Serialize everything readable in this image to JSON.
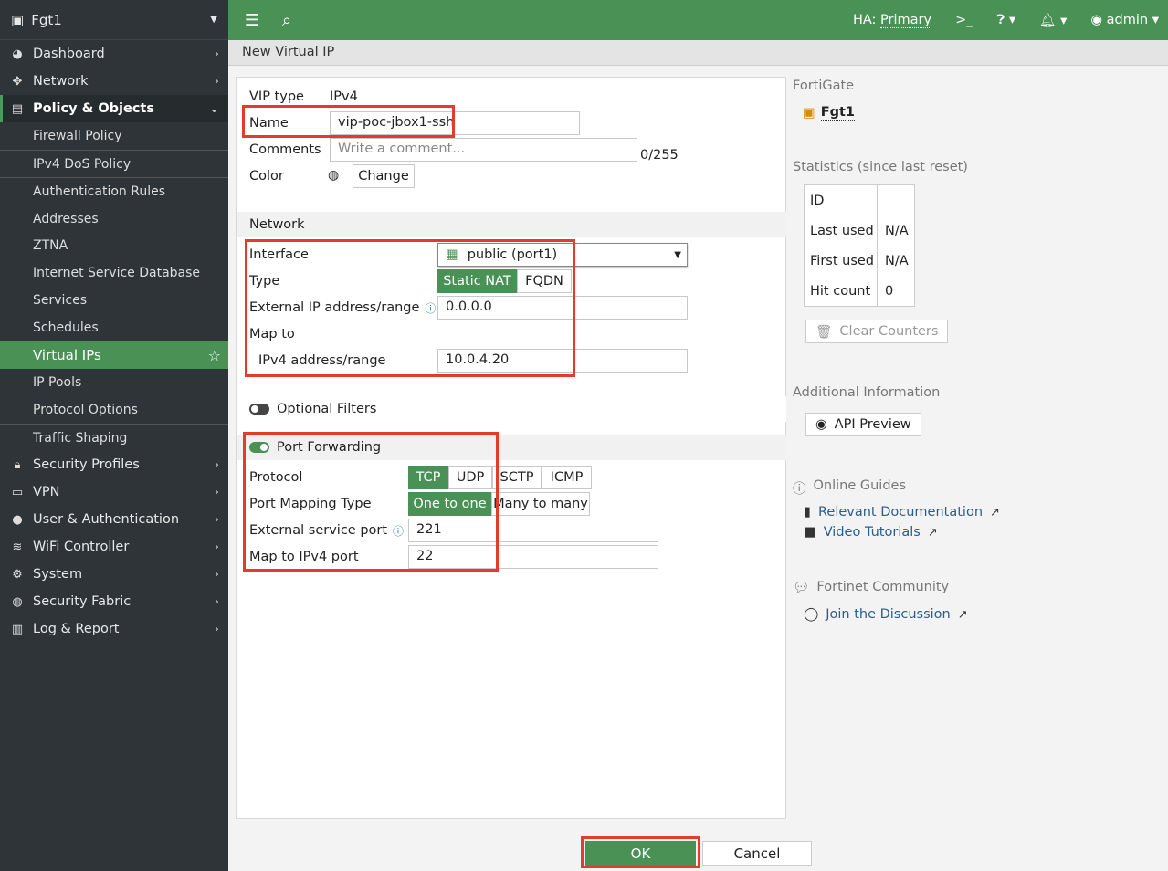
{
  "sidebar": {
    "device": "Fgt1",
    "items": [
      {
        "label": "Dashboard",
        "icon": "dashboard-icon"
      },
      {
        "label": "Network",
        "icon": "network-icon"
      },
      {
        "label": "Policy & Objects",
        "icon": "policy-icon"
      }
    ],
    "sub_items": [
      "Firewall Policy",
      "IPv4 DoS Policy",
      "Authentication Rules",
      "Addresses",
      "ZTNA",
      "Internet Service Database",
      "Services",
      "Schedules",
      "Virtual IPs",
      "IP Pools",
      "Protocol Options",
      "Traffic Shaping"
    ],
    "items_after": [
      "Security Profiles",
      "VPN",
      "User & Authentication",
      "WiFi Controller",
      "System",
      "Security Fabric",
      "Log & Report"
    ]
  },
  "topbar": {
    "ha_label": "HA:",
    "ha_value": "Primary",
    "user": "admin"
  },
  "breadcrumb": "New Virtual IP",
  "form": {
    "vip_type_label": "VIP type",
    "vip_type_value": "IPv4",
    "name_label": "Name",
    "name_value": "vip-poc-jbox1-ssh",
    "comments_label": "Comments",
    "comments_placeholder": "Write a comment...",
    "comments_count": "0/255",
    "color_label": "Color",
    "change_button": "Change",
    "network_section": "Network",
    "interface_label": "Interface",
    "interface_value": "public (port1)",
    "type_label": "Type",
    "type_options": [
      "Static NAT",
      "FQDN"
    ],
    "ext_ip_label": "External IP address/range",
    "ext_ip_value": "0.0.0.0",
    "map_to_label": "Map to",
    "ipv4_range_label": "IPv4 address/range",
    "ipv4_range_value": "10.0.4.20",
    "optional_filters": "Optional Filters",
    "port_forwarding": "Port Forwarding",
    "protocol_label": "Protocol",
    "protocol_options": [
      "TCP",
      "UDP",
      "SCTP",
      "ICMP"
    ],
    "port_mapping_label": "Port Mapping Type",
    "port_mapping_options": [
      "One to one",
      "Many to many"
    ],
    "ext_port_label": "External service port",
    "ext_port_value": "221",
    "map_port_label": "Map to IPv4 port",
    "map_port_value": "22"
  },
  "right_panel": {
    "fortigate_title": "FortiGate",
    "device_name": "Fgt1",
    "stats_title": "Statistics (since last reset)",
    "stats": [
      {
        "k": "ID",
        "v": ""
      },
      {
        "k": "Last used",
        "v": "N/A"
      },
      {
        "k": "First used",
        "v": "N/A"
      },
      {
        "k": "Hit count",
        "v": "0"
      }
    ],
    "clear_counters": "Clear Counters",
    "additional_info": "Additional Information",
    "api_preview": "API Preview",
    "online_guides": "Online Guides",
    "relevant_docs": "Relevant Documentation",
    "video_tutorials": "Video Tutorials",
    "community": "Fortinet Community",
    "join_discussion": "Join the Discussion"
  },
  "footer": {
    "ok": "OK",
    "cancel": "Cancel"
  }
}
